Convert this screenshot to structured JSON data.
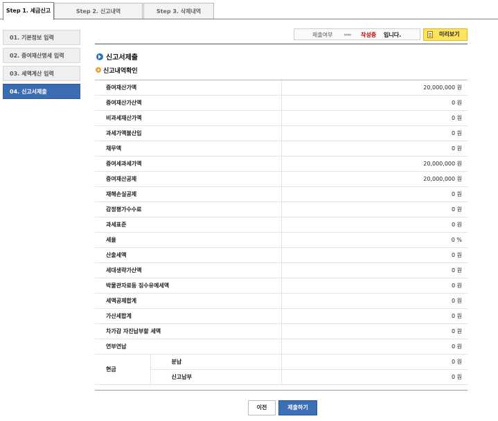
{
  "tabs": [
    {
      "label": "Step 1. 세금신고",
      "active": true
    },
    {
      "label": "Step 2. 신고내역",
      "active": false
    },
    {
      "label": "Step 3. 삭제내역",
      "active": false
    }
  ],
  "sidebar": {
    "items": [
      {
        "label": "01. 기본정보 입력",
        "active": false
      },
      {
        "label": "02. 증여재산명세 입력",
        "active": false
      },
      {
        "label": "03. 세액계산 입력",
        "active": false
      },
      {
        "label": "04. 신고서제출",
        "active": true
      }
    ]
  },
  "status": {
    "prefix": "제출여부",
    "arrows": "▸▸▸▸",
    "value": "작성중",
    "suffix": "입니다.",
    "status_color": "#cc0000"
  },
  "preview_button": {
    "label": "미리보기",
    "icon": "document-icon"
  },
  "section": {
    "title": "신고서제출",
    "subtitle": "신고내역확인"
  },
  "table": {
    "rows": [
      {
        "label": "증여재산가액",
        "value": "20,000,000 원"
      },
      {
        "label": "증여재산가산액",
        "value": "0 원"
      },
      {
        "label": "비과세재산가액",
        "value": "0 원"
      },
      {
        "label": "과세가액불산입",
        "value": "0 원"
      },
      {
        "label": "채무액",
        "value": "0 원"
      },
      {
        "label": "증여세과세가액",
        "value": "20,000,000 원"
      },
      {
        "label": "증여재산공제",
        "value": "20,000,000 원"
      },
      {
        "label": "재해손실공제",
        "value": "0 원"
      },
      {
        "label": "감정평가수수료",
        "value": "0 원"
      },
      {
        "label": "과세표준",
        "value": "0 원"
      },
      {
        "label": "세율",
        "value": "0 %"
      },
      {
        "label": "산출세액",
        "value": "0 원"
      },
      {
        "label": "세대생략가산액",
        "value": "0 원"
      },
      {
        "label": "박물관자료등 징수유예세액",
        "value": "0 원"
      },
      {
        "label": "세액공제합계",
        "value": "0 원"
      },
      {
        "label": "가산세합계",
        "value": "0 원"
      },
      {
        "label": "차가감 자진납부할 세액",
        "value": "0 원"
      },
      {
        "label": "연부연납",
        "value": "0 원"
      }
    ],
    "cash": {
      "label": "현금",
      "rows": [
        {
          "label": "분납",
          "value": "0 원"
        },
        {
          "label": "신고납부",
          "value": "0 원"
        }
      ]
    }
  },
  "buttons": {
    "prev": "이전",
    "submit": "제출하기"
  }
}
